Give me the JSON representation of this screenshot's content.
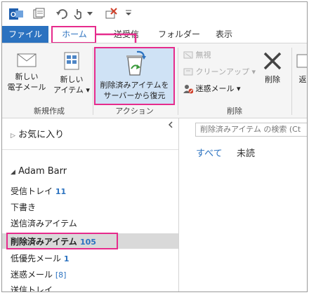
{
  "ribbon_tabs": [
    {
      "label": "ファイル"
    },
    {
      "label": "ホーム"
    },
    {
      "label": "送受信"
    },
    {
      "label": "フォルダー"
    },
    {
      "label": "表示"
    }
  ],
  "ribbon": {
    "new_email": {
      "line1": "新しい",
      "line2": "電子メール"
    },
    "new_items": {
      "line1": "新しい",
      "line2": "アイテム ▾"
    },
    "new_group_label": "新規作成",
    "recover": {
      "line1": "削除済みアイテムを",
      "line2": "サーバーから復元"
    },
    "action_group_label": "アクション",
    "ignore": "無視",
    "cleanup": "クリーンアップ ▾",
    "junk": "迷惑メール ▾",
    "delete_big": "削除",
    "delete_group_label": "削除",
    "partial_next": "返"
  },
  "nav": {
    "favorites": "お気に入り",
    "account": "Adam Barr",
    "folders": [
      {
        "name": "受信トレイ",
        "count": "11"
      },
      {
        "name": "下書き",
        "count": ""
      },
      {
        "name": "送信済みアイテム",
        "count": ""
      },
      {
        "name": "削除済みアイテム",
        "count": "105"
      },
      {
        "name": "低優先メール",
        "count": "1"
      },
      {
        "name": "迷惑メール",
        "count": "[8]"
      },
      {
        "name": "送信トレイ",
        "count": ""
      }
    ]
  },
  "main": {
    "search_placeholder": "削除済みアイテム の検索 (Ct",
    "filter_all": "すべて",
    "filter_unread": "未読"
  },
  "colors": {
    "accent": "#2b72c0",
    "highlight": "#e62b8c"
  }
}
